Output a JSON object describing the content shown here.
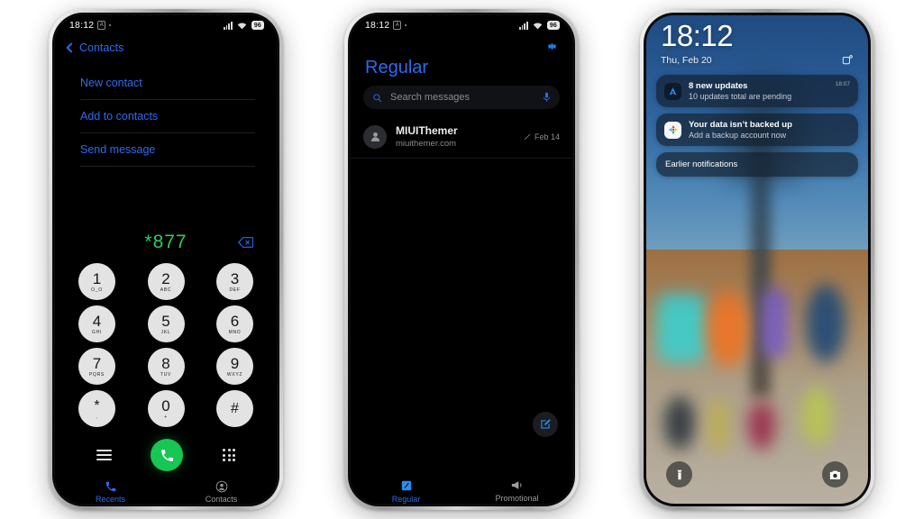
{
  "statusbar": {
    "time": "18:12",
    "alarm_badge": "A",
    "battery": "96",
    "icons": [
      "signal-bars-icon",
      "wifi-icon",
      "battery-icon"
    ]
  },
  "phone1": {
    "name": "dialer-screen",
    "back_label": "Contacts",
    "actions": [
      {
        "label": "New contact"
      },
      {
        "label": "Add to contacts"
      },
      {
        "label": "Send message"
      }
    ],
    "dialed_number": "*877",
    "number_color": "#2ecc5e",
    "keypad": [
      {
        "num": "1",
        "sub": "O_O"
      },
      {
        "num": "2",
        "sub": "ABC"
      },
      {
        "num": "3",
        "sub": "DEF"
      },
      {
        "num": "4",
        "sub": "GHI"
      },
      {
        "num": "5",
        "sub": "JKL"
      },
      {
        "num": "6",
        "sub": "MNO"
      },
      {
        "num": "7",
        "sub": "PQRS"
      },
      {
        "num": "8",
        "sub": "TUV"
      },
      {
        "num": "9",
        "sub": "WXYZ"
      },
      {
        "num": "*",
        "sub": ","
      },
      {
        "num": "0",
        "sub": "+"
      },
      {
        "num": "#",
        "sub": ""
      }
    ],
    "tabs": [
      {
        "label": "Recents",
        "active": true
      },
      {
        "label": "Contacts",
        "active": false
      }
    ],
    "accent": "#2a6cf0"
  },
  "phone2": {
    "name": "messages-screen",
    "title": "Regular",
    "search_placeholder": "Search messages",
    "conversations": [
      {
        "name": "MIUIThemer",
        "preview": "miuithemer.com",
        "date": "Feb 14"
      }
    ],
    "tabs": [
      {
        "label": "Regular",
        "active": true
      },
      {
        "label": "Promotional",
        "active": false
      }
    ],
    "accent": "#2a6cf0"
  },
  "phone3": {
    "name": "lockscreen",
    "time": "18:12",
    "date": "Thu, Feb 20",
    "notifications": [
      {
        "title": "8 new updates",
        "body": "10 updates total are pending",
        "time": "18:07",
        "icon": "app-store-icon"
      },
      {
        "title": "Your data isn’t backed up",
        "body": "Add a backup account now",
        "time": "",
        "icon": "google-one-icon"
      }
    ],
    "earlier_label": "Earlier notifications",
    "shortcuts": [
      {
        "label": "flashlight-shortcut"
      },
      {
        "label": "camera-shortcut"
      }
    ]
  }
}
